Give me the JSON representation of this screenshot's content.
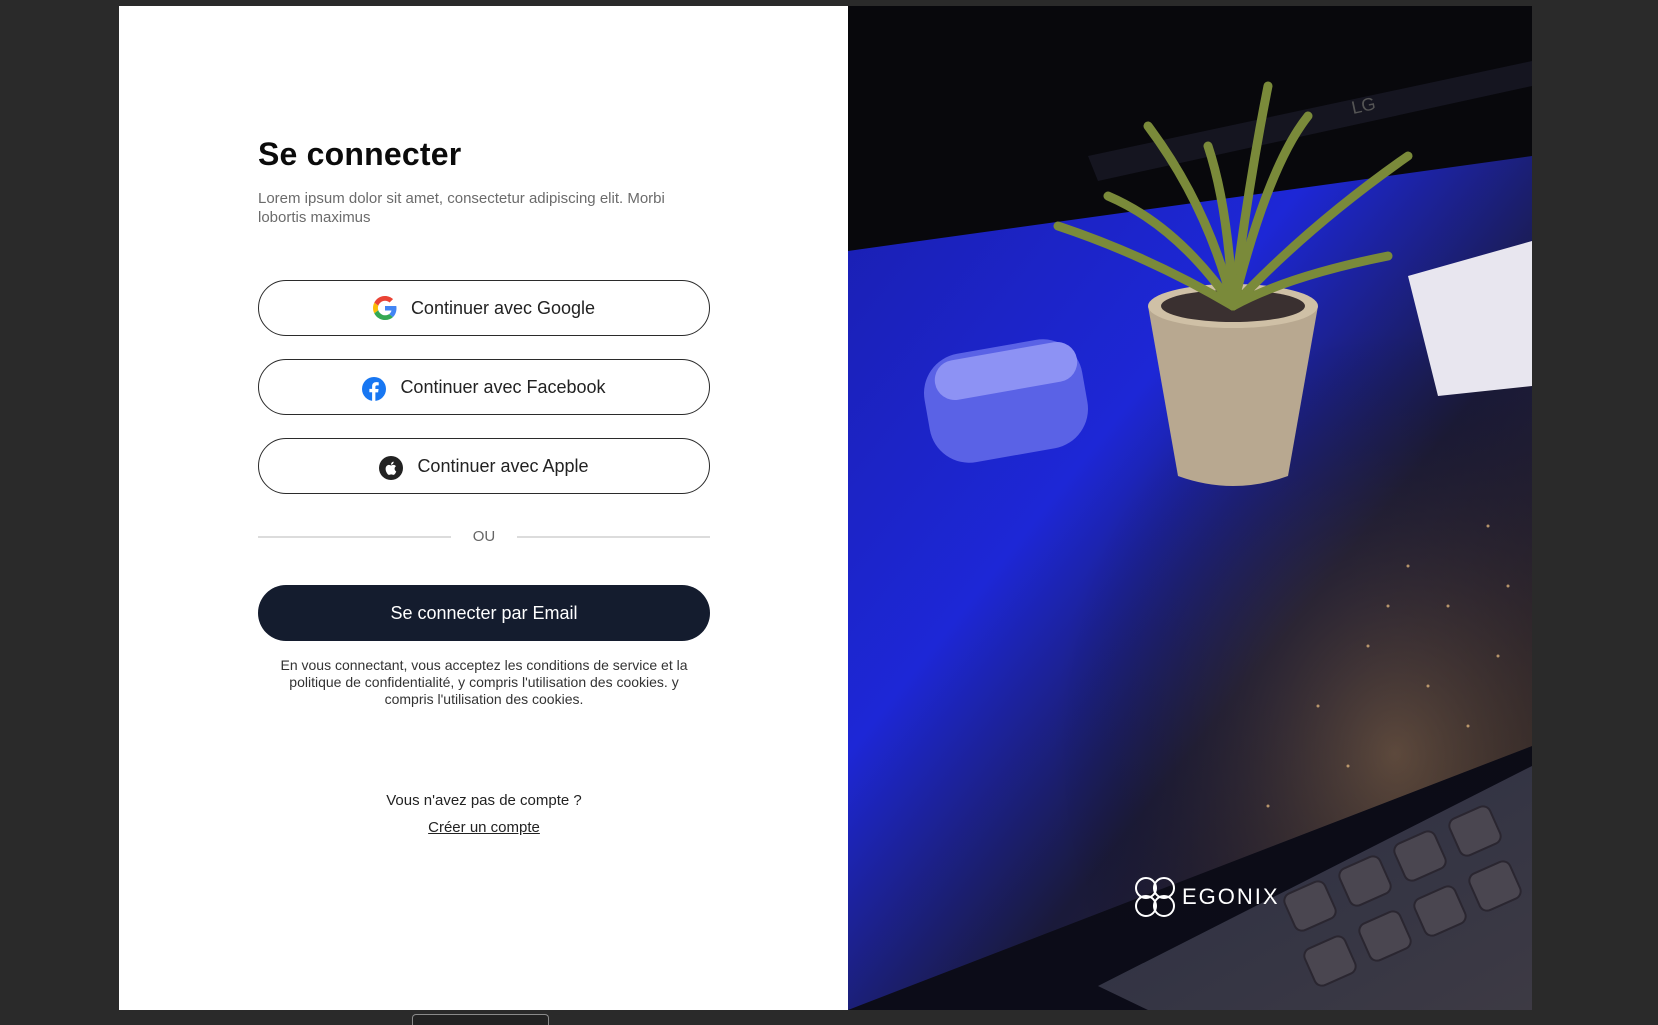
{
  "login": {
    "title": "Se connecter",
    "subtitle": "Lorem ipsum dolor sit amet, consectetur adipiscing elit. Morbi lobortis maximus",
    "google_label": "Continuer avec Google",
    "facebook_label": "Continuer avec Facebook",
    "apple_label": "Continuer avec Apple",
    "divider_text": "OU",
    "email_label": "Se connecter par Email",
    "legal_text": "En vous connectant, vous acceptez les conditions de service et la politique de confidentialité, y compris l'utilisation des cookies. y compris l'utilisation des cookies.",
    "no_account_text": "Vous n'avez pas de compte ?",
    "create_account_link": "Créer un compte"
  },
  "brand": {
    "name": "EGONIX"
  },
  "colors": {
    "primary_button": "#141c2e",
    "facebook": "#1877f2",
    "background": "#2a2a2a"
  }
}
